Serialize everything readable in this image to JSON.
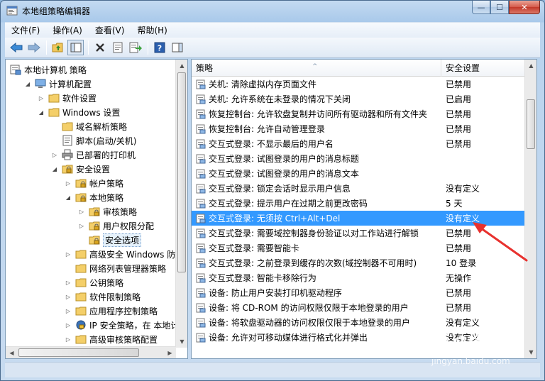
{
  "window": {
    "title": "本地组策略编辑器",
    "minimize": "—",
    "maximize": "☐",
    "close": "✕"
  },
  "menu": [
    "文件(F)",
    "操作(A)",
    "查看(V)",
    "帮助(H)"
  ],
  "toolbar": {
    "icons": [
      "back-arrow-icon",
      "forward-arrow-icon",
      "up-folder-icon",
      "show-hide-tree-icon",
      "delete-icon",
      "properties-icon",
      "export-list-icon",
      "help-icon",
      "show-hide-action-icon"
    ]
  },
  "tree": [
    {
      "label": "本地计算机 策略",
      "depth": 0,
      "twisty": "",
      "icon": "computer-policy"
    },
    {
      "label": "计算机配置",
      "depth": 1,
      "twisty": "open",
      "icon": "computer"
    },
    {
      "label": "软件设置",
      "depth": 2,
      "twisty": "closed",
      "icon": "folder"
    },
    {
      "label": "Windows 设置",
      "depth": 2,
      "twisty": "open",
      "icon": "folder"
    },
    {
      "label": "域名解析策略",
      "depth": 3,
      "twisty": "",
      "icon": "folder"
    },
    {
      "label": "脚本(启动/关机)",
      "depth": 3,
      "twisty": "",
      "icon": "script"
    },
    {
      "label": "已部署的打印机",
      "depth": 3,
      "twisty": "closed",
      "icon": "printer"
    },
    {
      "label": "安全设置",
      "depth": 3,
      "twisty": "open",
      "icon": "security"
    },
    {
      "label": "帐户策略",
      "depth": 4,
      "twisty": "closed",
      "icon": "folder-lock"
    },
    {
      "label": "本地策略",
      "depth": 4,
      "twisty": "open",
      "icon": "folder-lock"
    },
    {
      "label": "审核策略",
      "depth": 5,
      "twisty": "closed",
      "icon": "folder-lock"
    },
    {
      "label": "用户权限分配",
      "depth": 5,
      "twisty": "closed",
      "icon": "folder-lock"
    },
    {
      "label": "安全选项",
      "depth": 5,
      "twisty": "",
      "icon": "folder-lock",
      "selected": true
    },
    {
      "label": "高级安全 Windows 防火",
      "depth": 4,
      "twisty": "closed",
      "icon": "folder"
    },
    {
      "label": "网络列表管理器策略",
      "depth": 4,
      "twisty": "",
      "icon": "folder"
    },
    {
      "label": "公钥策略",
      "depth": 4,
      "twisty": "closed",
      "icon": "folder"
    },
    {
      "label": "软件限制策略",
      "depth": 4,
      "twisty": "closed",
      "icon": "folder"
    },
    {
      "label": "应用程序控制策略",
      "depth": 4,
      "twisty": "closed",
      "icon": "folder"
    },
    {
      "label": "IP 安全策略，在 本地计算",
      "depth": 4,
      "twisty": "closed",
      "icon": "ipsec"
    },
    {
      "label": "高级审核策略配置",
      "depth": 4,
      "twisty": "closed",
      "icon": "folder"
    }
  ],
  "list": {
    "col_policy": "策略",
    "col_setting": "安全设置",
    "sort_indicator": "^",
    "rows": [
      {
        "policy": "关机: 清除虚拟内存页面文件",
        "setting": "已禁用"
      },
      {
        "policy": "关机: 允许系统在未登录的情况下关闭",
        "setting": "已启用"
      },
      {
        "policy": "恢复控制台: 允许软盘复制并访问所有驱动器和所有文件夹",
        "setting": "已禁用"
      },
      {
        "policy": "恢复控制台: 允许自动管理登录",
        "setting": "已禁用"
      },
      {
        "policy": "交互式登录: 不显示最后的用户名",
        "setting": "已禁用"
      },
      {
        "policy": "交互式登录: 试图登录的用户的消息标题",
        "setting": ""
      },
      {
        "policy": "交互式登录: 试图登录的用户的消息文本",
        "setting": ""
      },
      {
        "policy": "交互式登录: 锁定会话时显示用户信息",
        "setting": "没有定义"
      },
      {
        "policy": "交互式登录: 提示用户在过期之前更改密码",
        "setting": "5 天"
      },
      {
        "policy": "交互式登录: 无须按 Ctrl+Alt+Del",
        "setting": "没有定义",
        "selected": true
      },
      {
        "policy": "交互式登录: 需要域控制器身份验证以对工作站进行解锁",
        "setting": "已禁用"
      },
      {
        "policy": "交互式登录: 需要智能卡",
        "setting": "已禁用"
      },
      {
        "policy": "交互式登录: 之前登录到缓存的次数(域控制器不可用时)",
        "setting": "10 登录"
      },
      {
        "policy": "交互式登录: 智能卡移除行为",
        "setting": "无操作"
      },
      {
        "policy": "设备: 防止用户安装打印机驱动程序",
        "setting": "已禁用"
      },
      {
        "policy": "设备: 将 CD-ROM 的访问权限仅限于本地登录的用户",
        "setting": "已禁用"
      },
      {
        "policy": "设备: 将软盘驱动器的访问权限仅限于本地登录的用户",
        "setting": "没有定义"
      },
      {
        "policy": "设备: 允许对可移动媒体进行格式化并弹出",
        "setting": "没有定义"
      }
    ]
  },
  "watermark": {
    "brand": "Bai",
    "brand2": "du",
    "suffix": "经验",
    "url": "jingyan.baidu.com"
  },
  "colors": {
    "selection": "#3399ff",
    "annotation": "#e8312e"
  }
}
